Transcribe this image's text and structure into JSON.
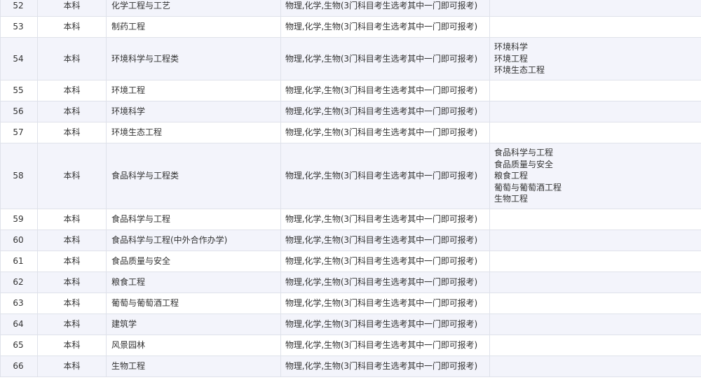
{
  "rows": [
    {
      "num": "52",
      "level": "本科",
      "major": "化学工程与工艺",
      "subjects": "物理,化学,生物(3门科目考生选考其中一门即可报考)",
      "includes": []
    },
    {
      "num": "53",
      "level": "本科",
      "major": "制药工程",
      "subjects": "物理,化学,生物(3门科目考生选考其中一门即可报考)",
      "includes": []
    },
    {
      "num": "54",
      "level": "本科",
      "major": "环境科学与工程类",
      "subjects": "物理,化学,生物(3门科目考生选考其中一门即可报考)",
      "includes": [
        "环境科学",
        "环境工程",
        "环境生态工程"
      ]
    },
    {
      "num": "55",
      "level": "本科",
      "major": "环境工程",
      "subjects": "物理,化学,生物(3门科目考生选考其中一门即可报考)",
      "includes": []
    },
    {
      "num": "56",
      "level": "本科",
      "major": "环境科学",
      "subjects": "物理,化学,生物(3门科目考生选考其中一门即可报考)",
      "includes": []
    },
    {
      "num": "57",
      "level": "本科",
      "major": "环境生态工程",
      "subjects": "物理,化学,生物(3门科目考生选考其中一门即可报考)",
      "includes": []
    },
    {
      "num": "58",
      "level": "本科",
      "major": "食品科学与工程类",
      "subjects": "物理,化学,生物(3门科目考生选考其中一门即可报考)",
      "includes": [
        "食品科学与工程",
        "食品质量与安全",
        "粮食工程",
        "葡萄与葡萄酒工程",
        "生物工程"
      ]
    },
    {
      "num": "59",
      "level": "本科",
      "major": "食品科学与工程",
      "subjects": "物理,化学,生物(3门科目考生选考其中一门即可报考)",
      "includes": []
    },
    {
      "num": "60",
      "level": "本科",
      "major": "食品科学与工程(中外合作办学)",
      "subjects": "物理,化学,生物(3门科目考生选考其中一门即可报考)",
      "includes": []
    },
    {
      "num": "61",
      "level": "本科",
      "major": "食品质量与安全",
      "subjects": "物理,化学,生物(3门科目考生选考其中一门即可报考)",
      "includes": []
    },
    {
      "num": "62",
      "level": "本科",
      "major": "粮食工程",
      "subjects": "物理,化学,生物(3门科目考生选考其中一门即可报考)",
      "includes": []
    },
    {
      "num": "63",
      "level": "本科",
      "major": "葡萄与葡萄酒工程",
      "subjects": "物理,化学,生物(3门科目考生选考其中一门即可报考)",
      "includes": []
    },
    {
      "num": "64",
      "level": "本科",
      "major": "建筑学",
      "subjects": "物理,化学,生物(3门科目考生选考其中一门即可报考)",
      "includes": []
    },
    {
      "num": "65",
      "level": "本科",
      "major": "风景园林",
      "subjects": "物理,化学,生物(3门科目考生选考其中一门即可报考)",
      "includes": []
    },
    {
      "num": "66",
      "level": "本科",
      "major": "生物工程",
      "subjects": "物理,化学,生物(3门科目考生选考其中一门即可报考)",
      "includes": []
    }
  ]
}
